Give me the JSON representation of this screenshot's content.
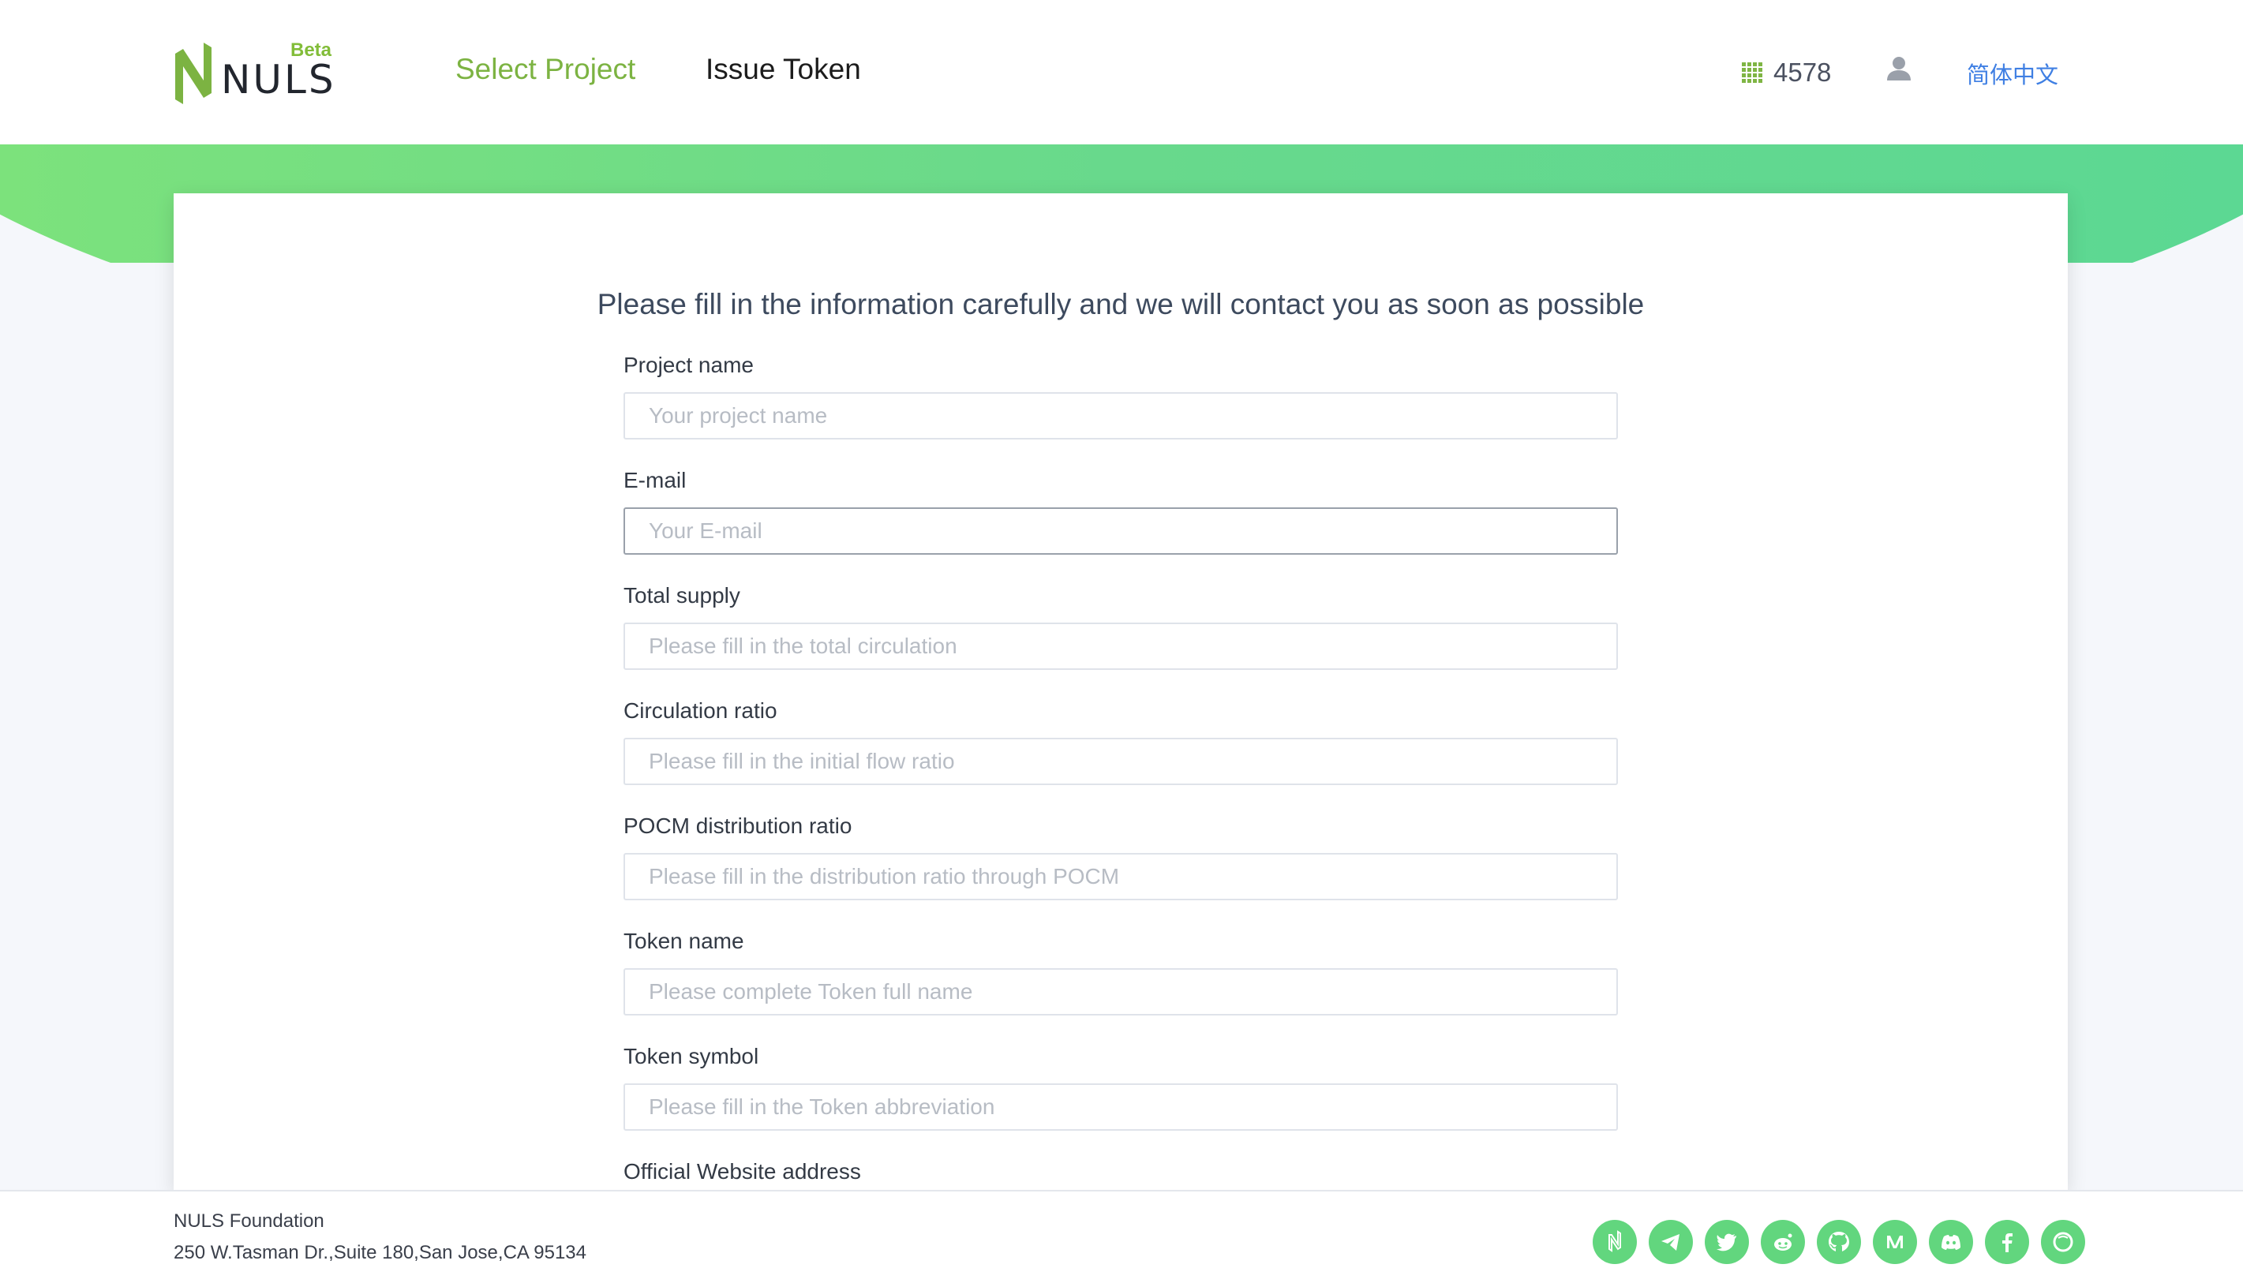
{
  "header": {
    "logo_beta": "Beta",
    "logo_text": "NULS",
    "nav": [
      {
        "label": "Select Project"
      },
      {
        "label": "Issue Token"
      }
    ],
    "block_height": "4578",
    "language": "简体中文"
  },
  "form": {
    "title": "Please fill in the information carefully and we will contact you as soon as possible",
    "fields": [
      {
        "label": "Project name",
        "placeholder": "Your project name"
      },
      {
        "label": "E-mail",
        "placeholder": "Your E-mail"
      },
      {
        "label": "Total supply",
        "placeholder": "Please fill in the total circulation"
      },
      {
        "label": "Circulation ratio",
        "placeholder": "Please fill in the initial flow ratio"
      },
      {
        "label": "POCM distribution ratio",
        "placeholder": "Please fill in the distribution ratio through POCM"
      },
      {
        "label": "Token name",
        "placeholder": "Please complete Token full name"
      },
      {
        "label": "Token symbol",
        "placeholder": "Please fill in the Token abbreviation"
      },
      {
        "label": "Official Website address"
      }
    ]
  },
  "footer": {
    "org": "NULS Foundation",
    "address": "250 W.Tasman Dr.,Suite 180,San Jose,CA 95134",
    "socials": [
      "nuls-icon",
      "telegram-icon",
      "twitter-icon",
      "reddit-icon",
      "github-icon",
      "medium-icon",
      "discord-icon",
      "facebook-icon",
      "forum-icon"
    ]
  },
  "colors": {
    "brand_green": "#7cb342",
    "social_green": "#62d67e",
    "link_blue": "#3f7fe3"
  }
}
